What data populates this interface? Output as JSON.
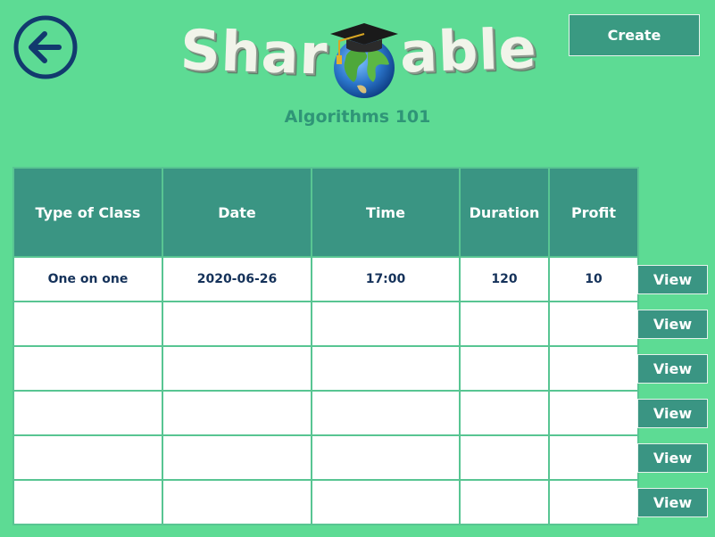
{
  "header": {
    "logo_left": "Shar",
    "logo_right": "able",
    "class_title": "Algorithms 101",
    "create_label": "Create"
  },
  "table": {
    "columns": [
      "Type of Class",
      "Date",
      "Time",
      "Duration",
      "Profit"
    ],
    "rows": [
      [
        "One on one",
        "2020-06-26",
        "17:00",
        "120",
        "10"
      ],
      [
        "",
        "",
        "",
        "",
        ""
      ],
      [
        "",
        "",
        "",
        "",
        ""
      ],
      [
        "",
        "",
        "",
        "",
        ""
      ],
      [
        "",
        "",
        "",
        "",
        ""
      ],
      [
        "",
        "",
        "",
        "",
        ""
      ]
    ],
    "view_label": "View"
  },
  "colors": {
    "background": "#5ddb94",
    "accent": "#3a9583",
    "title": "#2f9577",
    "back_icon": "#123a6e"
  },
  "icons": {
    "back": "back-arrow-circle-icon",
    "logo_globe": "globe-graduation-cap-icon"
  }
}
